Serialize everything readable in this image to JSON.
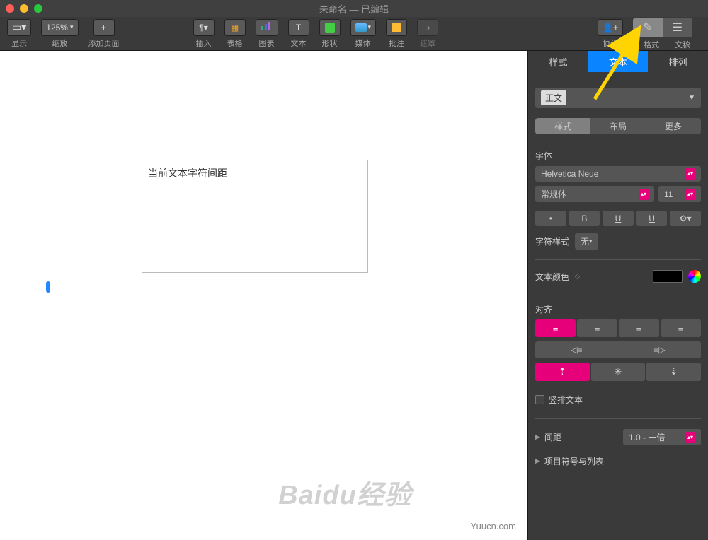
{
  "titlebar": {
    "title": "未命名 — 已编辑"
  },
  "toolbar": {
    "view_label": "显示",
    "zoom_value": "125%",
    "zoom_label": "缩放",
    "add_page_label": "添加页面",
    "insert_label": "插入",
    "table_label": "表格",
    "chart_label": "图表",
    "text_label": "文本",
    "shape_label": "形状",
    "media_label": "媒体",
    "comments_label": "批注",
    "mask_label": "遮罩",
    "collab_label": "协作",
    "format_label": "格式",
    "doc_label": "文稿"
  },
  "inspector": {
    "tabs": {
      "style": "样式",
      "text": "文本",
      "arrange": "排列"
    },
    "paragraph_style": "正文",
    "subtabs": {
      "style": "样式",
      "layout": "布局",
      "more": "更多"
    },
    "font_label": "字体",
    "font_family": "Helvetica Neue",
    "font_weight": "常规体",
    "font_size": "11",
    "bold": "B",
    "underline": "U",
    "underline2": "U",
    "char_style_label": "字符样式",
    "char_style_value": "无",
    "text_color_label": "文本颜色",
    "align_label": "对齐",
    "vertical_text_label": "竖排文本",
    "spacing_label": "间距",
    "spacing_value": "1.0 - 一倍",
    "bullets_label": "项目符号与列表"
  },
  "canvas": {
    "textbox_content": "当前文本字符间距"
  },
  "watermark": "Baidu经验",
  "site": "Yuucn.com"
}
